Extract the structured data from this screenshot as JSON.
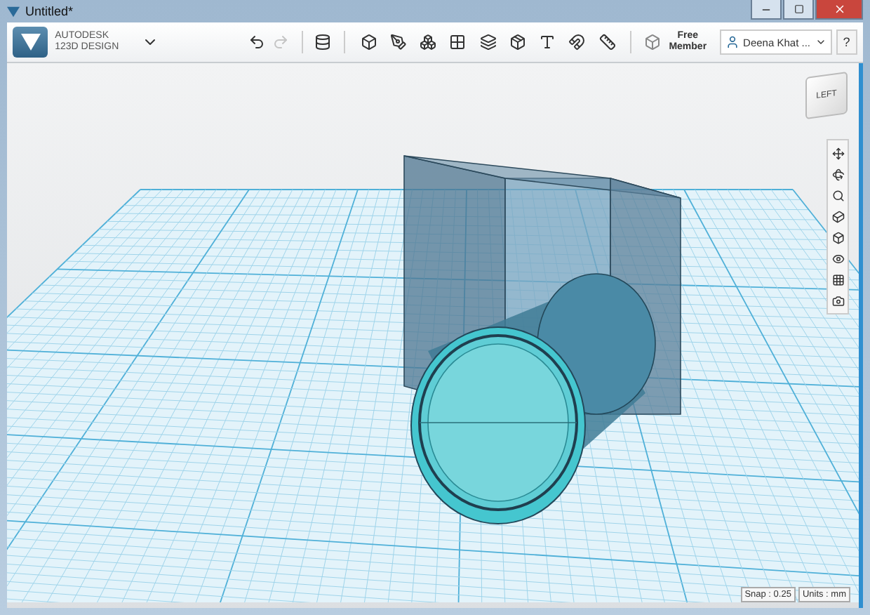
{
  "window": {
    "title": "Untitled*"
  },
  "app": {
    "brand_line_1": "AUTODESK",
    "brand_line_2": "123D DESIGN"
  },
  "toolbar": {
    "undo": {
      "disabled": false
    },
    "redo": {
      "disabled": true
    },
    "membership": "Free Member",
    "user": "Deena Khat ...",
    "help": "?"
  },
  "view_cube": {
    "face": "LEFT"
  },
  "status": {
    "snap": "Snap : 0.25",
    "units": "Units : mm"
  }
}
